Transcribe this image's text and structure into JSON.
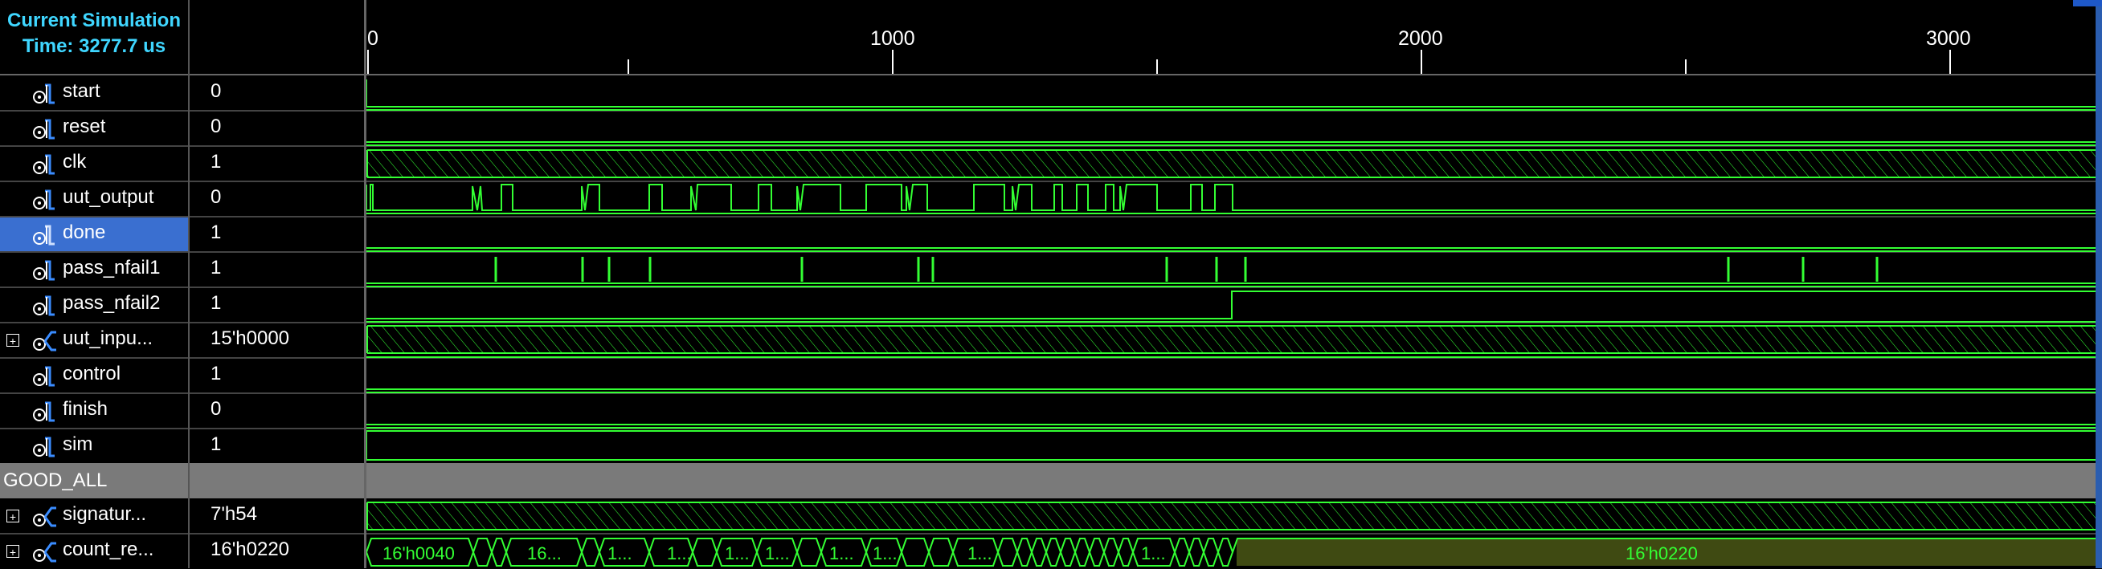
{
  "header": {
    "line1": "Current Simulation",
    "line2": "Time: 3277.7 us"
  },
  "timeline": {
    "labels": [
      "0",
      "1000",
      "2000",
      "3000"
    ]
  },
  "signals": [
    {
      "name": "start",
      "value": "0",
      "bus": false
    },
    {
      "name": "reset",
      "value": "0",
      "bus": false
    },
    {
      "name": "clk",
      "value": "1",
      "bus": false
    },
    {
      "name": "uut_output",
      "value": "0",
      "bus": false
    },
    {
      "name": "done",
      "value": "1",
      "bus": false,
      "selected": true
    },
    {
      "name": "pass_nfail1",
      "value": "1",
      "bus": false
    },
    {
      "name": "pass_nfail2",
      "value": "1",
      "bus": false
    },
    {
      "name": "uut_inpu...",
      "value": "15'h0000",
      "bus": true
    },
    {
      "name": "control",
      "value": "1",
      "bus": false
    },
    {
      "name": "finish",
      "value": "0",
      "bus": false
    },
    {
      "name": "sim",
      "value": "1",
      "bus": false
    }
  ],
  "group": {
    "label": "GOOD_ALL"
  },
  "group_signals": [
    {
      "name": "signatur...",
      "value": "7'h54",
      "bus": true
    },
    {
      "name": "count_re...",
      "value": "16'h0220",
      "bus": true
    }
  ],
  "count_bus_labels": [
    "16'h0040",
    "16...",
    "1...",
    "1...",
    "1...",
    "1...",
    "1...",
    "1...",
    "1...",
    "1...",
    "1...",
    "16'h0220"
  ],
  "colors": {
    "wave": "#33ff33",
    "bus_fill": "#3f4a12",
    "selection": "#3a6fd0",
    "header_text": "#3fd6ff"
  }
}
